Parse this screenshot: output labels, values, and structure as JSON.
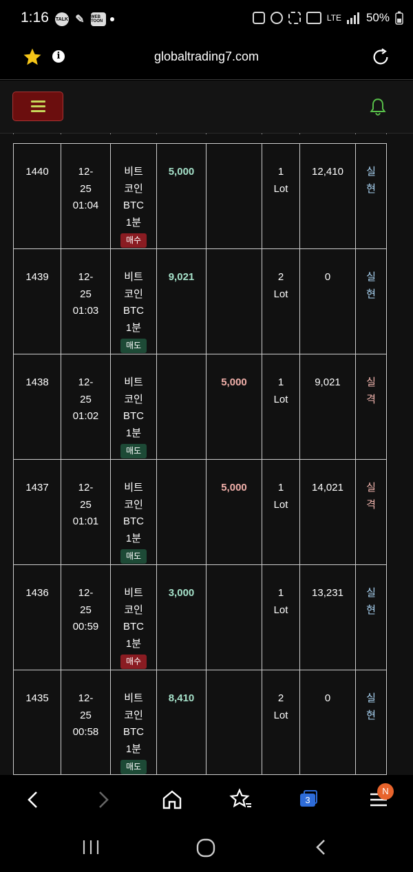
{
  "status_bar": {
    "time": "1:16",
    "notification_icons": [
      "TALK",
      "✎",
      "WEB TOON"
    ],
    "network": "LTE",
    "battery": "50%"
  },
  "browser": {
    "url": "globaltrading7.com",
    "tab_count": "3",
    "menu_badge": "N"
  },
  "trades": [
    {
      "id": "1440",
      "date": "12-",
      "date2": "25",
      "time": "01:04",
      "item1": "비트",
      "item2": "코인",
      "item3": "BTC",
      "item4": "1분",
      "side": "매수",
      "side_type": "buy",
      "profit": "5,000",
      "loss": "",
      "lot1": "1",
      "lot2": "Lot",
      "balance": "12,410",
      "result1": "실",
      "result2": "현",
      "result_type": "profit"
    },
    {
      "id": "1439",
      "date": "12-",
      "date2": "25",
      "time": "01:03",
      "item1": "비트",
      "item2": "코인",
      "item3": "BTC",
      "item4": "1분",
      "side": "매도",
      "side_type": "sell",
      "profit": "9,021",
      "loss": "",
      "lot1": "2",
      "lot2": "Lot",
      "balance": "0",
      "result1": "실",
      "result2": "현",
      "result_type": "profit"
    },
    {
      "id": "1438",
      "date": "12-",
      "date2": "25",
      "time": "01:02",
      "item1": "비트",
      "item2": "코인",
      "item3": "BTC",
      "item4": "1분",
      "side": "매도",
      "side_type": "sell",
      "profit": "",
      "loss": "5,000",
      "lot1": "1",
      "lot2": "Lot",
      "balance": "9,021",
      "result1": "실",
      "result2": "격",
      "result_type": "loss"
    },
    {
      "id": "1437",
      "date": "12-",
      "date2": "25",
      "time": "01:01",
      "item1": "비트",
      "item2": "코인",
      "item3": "BTC",
      "item4": "1분",
      "side": "매도",
      "side_type": "sell",
      "profit": "",
      "loss": "5,000",
      "lot1": "1",
      "lot2": "Lot",
      "balance": "14,021",
      "result1": "실",
      "result2": "격",
      "result_type": "loss"
    },
    {
      "id": "1436",
      "date": "12-",
      "date2": "25",
      "time": "00:59",
      "item1": "비트",
      "item2": "코인",
      "item3": "BTC",
      "item4": "1분",
      "side": "매수",
      "side_type": "buy",
      "profit": "3,000",
      "loss": "",
      "lot1": "1",
      "lot2": "Lot",
      "balance": "13,231",
      "result1": "실",
      "result2": "현",
      "result_type": "profit"
    },
    {
      "id": "1435",
      "date": "12-",
      "date2": "25",
      "time": "00:58",
      "item1": "비트",
      "item2": "코인",
      "item3": "BTC",
      "item4": "1분",
      "side": "매도",
      "side_type": "sell",
      "profit": "8,410",
      "loss": "",
      "lot1": "2",
      "lot2": "Lot",
      "balance": "0",
      "result1": "실",
      "result2": "현",
      "result_type": "profit"
    }
  ],
  "colors": {
    "buy_badge": "#8a1c22",
    "sell_badge": "#1d4a36",
    "profit_text": "#a6e2ca",
    "loss_text": "#f2b0aa",
    "menu_button": "#6b0e0e",
    "bell": "#59c24a",
    "tab_count_bg": "#2e6cd9",
    "menu_badge_bg": "#e8642c"
  }
}
